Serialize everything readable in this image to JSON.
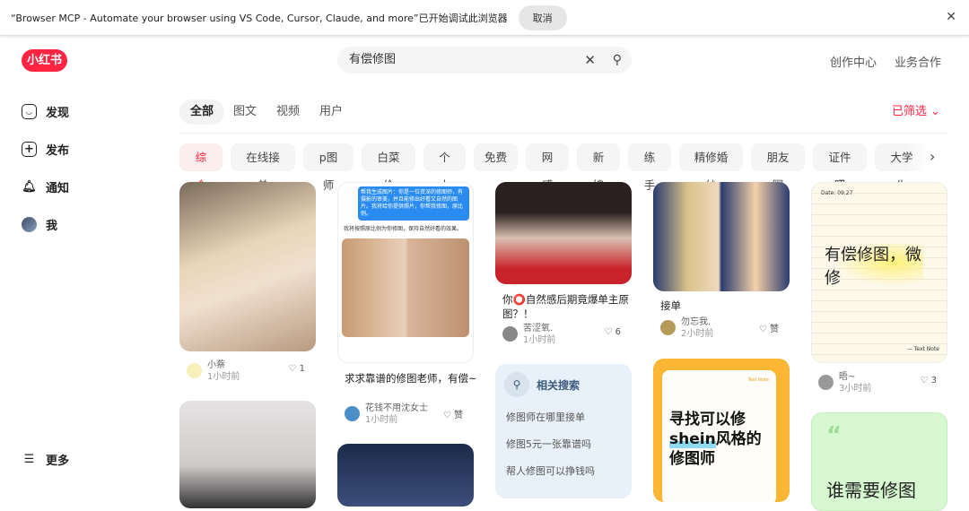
{
  "banner": {
    "message": "“Browser MCP - Automate your browser using VS Code, Cursor, Claude, and more”已开始调试此浏览器",
    "cancel": "取消"
  },
  "logo": "小红书",
  "search": {
    "value": "有偿修图"
  },
  "header_links": [
    "创作中心",
    "业务合作"
  ],
  "sidebar": {
    "items": [
      "发现",
      "发布",
      "通知",
      "我"
    ],
    "more": "更多"
  },
  "tabs": [
    "全部",
    "图文",
    "视频",
    "用户"
  ],
  "filter": "已筛选",
  "chips": [
    "综合",
    "在线接单",
    "p图师",
    "白菜价",
    "个人",
    "免费",
    "网感",
    "新娘",
    "练手",
    "精修婚纱",
    "朋友圈",
    "证件照",
    "大学生"
  ],
  "colors": {
    "brand": "#ff2442"
  },
  "notes": [
    {
      "title": "",
      "author": "小蔡",
      "time": "1小时前",
      "likes": "1"
    },
    {
      "title": "求求靠谱的修图老师，有偿~",
      "author": "花钱不用沈女士",
      "time": "1小时前",
      "likes": "赞",
      "overlay_top": "帮我生成图片：你是一位资深的修图师，有摄影的审美，并且能修出好看又自然的图片。我将给你提供照片，你帮我修图，原比例。",
      "overlay_bottom": "我将按照原比例为你修图，保持自然好看的效果。"
    },
    {
      "title": "你⭕自然感后期竟爆单主原图？！",
      "author": "苦涩氧.",
      "time": "1小时前",
      "likes": "6"
    },
    {
      "title": "接单",
      "author": "勿忘我.",
      "time": "2小时前",
      "likes": "赞"
    },
    {
      "title": "",
      "author": "晤~",
      "time": "3小时前",
      "likes": "3",
      "image_text": "有偿修图，微修",
      "image_sign": "— Text Note",
      "date_label": "Date: 09.27"
    }
  ],
  "related": {
    "title": "相关搜索",
    "items": [
      "修图师在哪里接单",
      "修图5元一张靠谱吗",
      "帮人修图可以挣钱吗"
    ]
  },
  "orange_card": {
    "line1": "寻找可以修",
    "line2a": "shein",
    "line2b": "风格的",
    "line3": "修图师",
    "tag": "Text Note"
  },
  "green_card": {
    "text": "谁需要修图"
  }
}
